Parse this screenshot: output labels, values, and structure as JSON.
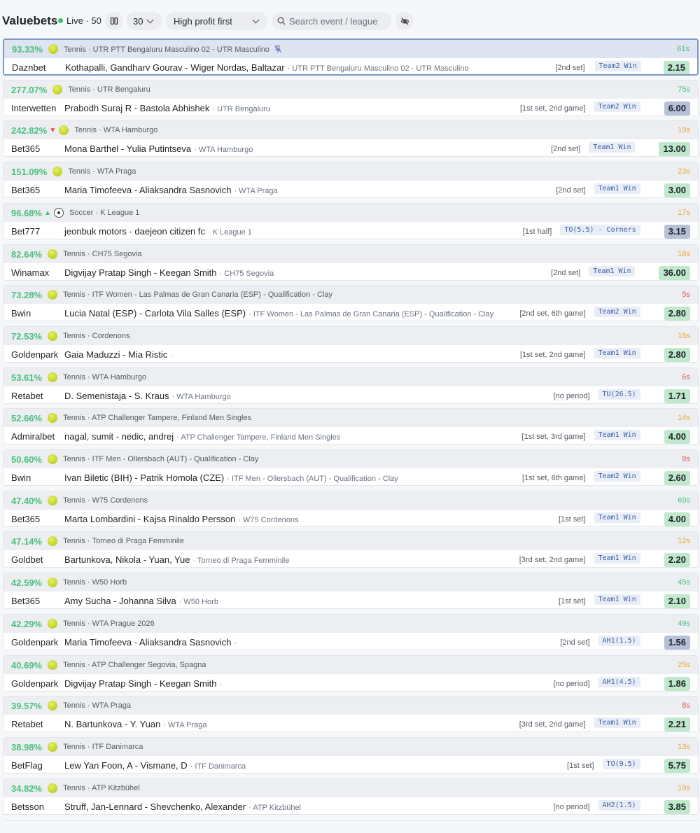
{
  "app": {
    "title": "Valuebets",
    "live_label": "Live · 50",
    "count_select": "30",
    "sort_select": "High profit first",
    "search_placeholder": "Search event / league",
    "colors": {
      "profit": "#4cc080",
      "live_dot": "#3fbf6f",
      "odds_green": "#bfe8cc",
      "odds_blue": "#b6c1d9",
      "market_text": "#3f5fa3"
    }
  },
  "bets": [
    {
      "profit": "93.33%",
      "trend": "",
      "sport": "tennis-ball-icon",
      "league_line": "Tennis · UTR PTT Bengaluru Masculino 02 - UTR Masculino",
      "pinned": true,
      "age": "61s",
      "age_color": "green",
      "bookie": "Daznbet",
      "event": "Kothapalli, Gandharv Gourav - Wiger Nordas, Baltazar",
      "event_league": "· UTR PTT Bengaluru Masculino 02 - UTR Masculino",
      "period": "[2nd set]",
      "market": "Team2 Win",
      "odds": "2.15",
      "odds_color": "green",
      "selected": true
    },
    {
      "profit": "277.07%",
      "trend": "",
      "sport": "tennis-ball-icon",
      "league_line": "Tennis · UTR Bengaluru",
      "pinned": false,
      "age": "75s",
      "age_color": "green",
      "bookie": "Interwetten",
      "event": "Prabodh Suraj R - Bastola Abhishek",
      "event_league": "· UTR Bengaluru",
      "period": "[1st set, 2nd game]",
      "market": "Team2 Win",
      "odds": "6.00",
      "odds_color": "blue",
      "selected": false
    },
    {
      "profit": "242.82%",
      "trend": "down",
      "sport": "tennis-ball-icon",
      "league_line": "Tennis · WTA Hamburgo",
      "pinned": false,
      "age": "19s",
      "age_color": "orange",
      "bookie": "Bet365",
      "event": "Mona Barthel - Yulia Putintseva",
      "event_league": "· WTA Hamburgo",
      "period": "[2nd set]",
      "market": "Team1 Win",
      "odds": "13.00",
      "odds_color": "green",
      "selected": false
    },
    {
      "profit": "151.09%",
      "trend": "",
      "sport": "tennis-ball-icon",
      "league_line": "Tennis · WTA Praga",
      "pinned": false,
      "age": "23s",
      "age_color": "orange",
      "bookie": "Bet365",
      "event": "Maria Timofeeva - Aliaksandra Sasnovich",
      "event_league": "· WTA Praga",
      "period": "[2nd set]",
      "market": "Team1 Win",
      "odds": "3.00",
      "odds_color": "green",
      "selected": false
    },
    {
      "profit": "96.68%",
      "trend": "up",
      "sport": "soccer-ball-icon",
      "league_line": "Soccer · K League 1",
      "pinned": false,
      "age": "17s",
      "age_color": "orange",
      "bookie": "Bet777",
      "event": "jeonbuk motors - daejeon citizen fc",
      "event_league": "· K League 1",
      "period": "[1st half]",
      "market": "TO(5.5) - Corners",
      "odds": "3.15",
      "odds_color": "blue",
      "selected": false
    },
    {
      "profit": "82.64%",
      "trend": "",
      "sport": "tennis-ball-icon",
      "league_line": "Tennis · CH75 Segovia",
      "pinned": false,
      "age": "18s",
      "age_color": "orange",
      "bookie": "Winamax",
      "event": "Digvijay Pratap Singh - Keegan Smith",
      "event_league": "· CH75 Segovia",
      "period": "[2nd set]",
      "market": "Team1 Win",
      "odds": "36.00",
      "odds_color": "green",
      "selected": false
    },
    {
      "profit": "73.28%",
      "trend": "",
      "sport": "tennis-ball-icon",
      "league_line": "Tennis · ITF Women - Las Palmas de Gran Canaria (ESP) - Qualification - Clay",
      "pinned": false,
      "age": "5s",
      "age_color": "red",
      "bookie": "Bwin",
      "event": "Lucia Natal (ESP) - Carlota Vila Salles (ESP)",
      "event_league": "· ITF Women - Las Palmas de Gran Canaria (ESP) - Qualification - Clay",
      "period": "[2nd set, 6th game]",
      "market": "Team2 Win",
      "odds": "2.80",
      "odds_color": "green",
      "selected": false
    },
    {
      "profit": "72.53%",
      "trend": "",
      "sport": "tennis-ball-icon",
      "league_line": "Tennis · Cordenons",
      "pinned": false,
      "age": "16s",
      "age_color": "orange",
      "bookie": "Goldenpark",
      "event": "Gaia Maduzzi - Mia Ristic",
      "event_league": "·",
      "period": "[1st set, 2nd game]",
      "market": "Team1 Win",
      "odds": "2.80",
      "odds_color": "green",
      "selected": false
    },
    {
      "profit": "53.61%",
      "trend": "",
      "sport": "tennis-ball-icon",
      "league_line": "Tennis · WTA Hamburgo",
      "pinned": false,
      "age": "6s",
      "age_color": "red",
      "bookie": "Retabet",
      "event": "D. Semenistaja - S. Kraus",
      "event_league": "· WTA Hamburgo",
      "period": "[no period]",
      "market": "TU(26.5)",
      "odds": "1.71",
      "odds_color": "green",
      "selected": false
    },
    {
      "profit": "52.66%",
      "trend": "",
      "sport": "tennis-ball-icon",
      "league_line": "Tennis · ATP Challenger Tampere, Finland Men Singles",
      "pinned": false,
      "age": "14s",
      "age_color": "orange",
      "bookie": "Admiralbet",
      "event": "nagal, sumit - nedic, andrej",
      "event_league": "· ATP Challenger Tampere, Finland Men Singles",
      "period": "[1st set, 3rd game]",
      "market": "Team1 Win",
      "odds": "4.00",
      "odds_color": "green",
      "selected": false
    },
    {
      "profit": "50.60%",
      "trend": "",
      "sport": "tennis-ball-icon",
      "league_line": "Tennis · ITF Men - Ollersbach (AUT) - Qualification - Clay",
      "pinned": false,
      "age": "8s",
      "age_color": "red",
      "bookie": "Bwin",
      "event": "Ivan Biletic (BIH) - Patrik Homola (CZE)",
      "event_league": "· ITF Men - Ollersbach (AUT) - Qualification - Clay",
      "period": "[1st set, 6th game]",
      "market": "Team2 Win",
      "odds": "2.60",
      "odds_color": "green",
      "selected": false
    },
    {
      "profit": "47.40%",
      "trend": "",
      "sport": "tennis-ball-icon",
      "league_line": "Tennis · W75 Cordenons",
      "pinned": false,
      "age": "69s",
      "age_color": "green",
      "bookie": "Bet365",
      "event": "Marta Lombardini - Kajsa Rinaldo Persson",
      "event_league": "· W75 Cordenons",
      "period": "[1st set]",
      "market": "Team1 Win",
      "odds": "4.00",
      "odds_color": "green",
      "selected": false
    },
    {
      "profit": "47.14%",
      "trend": "",
      "sport": "tennis-ball-icon",
      "league_line": "Tennis · Torneo di Praga Femminile",
      "pinned": false,
      "age": "12s",
      "age_color": "orange",
      "bookie": "Goldbet",
      "event": "Bartunkova, Nikola - Yuan, Yue",
      "event_league": "· Torneo di Praga Femminile",
      "period": "[3rd set, 2nd game]",
      "market": "Team1 Win",
      "odds": "2.20",
      "odds_color": "green",
      "selected": false
    },
    {
      "profit": "42.59%",
      "trend": "",
      "sport": "tennis-ball-icon",
      "league_line": "Tennis · W50 Horb",
      "pinned": false,
      "age": "45s",
      "age_color": "green",
      "bookie": "Bet365",
      "event": "Amy Sucha - Johanna Silva",
      "event_league": "· W50 Horb",
      "period": "[1st set]",
      "market": "Team1 Win",
      "odds": "2.10",
      "odds_color": "green",
      "selected": false
    },
    {
      "profit": "42.29%",
      "trend": "",
      "sport": "tennis-ball-icon",
      "league_line": "Tennis · WTA Prague 2026",
      "pinned": false,
      "age": "49s",
      "age_color": "green",
      "bookie": "Goldenpark",
      "event": "Maria Timofeeva - Aliaksandra Sasnovich",
      "event_league": "·",
      "period": "[2nd set]",
      "market": "AH1(1.5)",
      "odds": "1.56",
      "odds_color": "blue",
      "selected": false
    },
    {
      "profit": "40.69%",
      "trend": "",
      "sport": "tennis-ball-icon",
      "league_line": "Tennis · ATP Challenger Segovia, Spagna",
      "pinned": false,
      "age": "25s",
      "age_color": "orange",
      "bookie": "Goldenpark",
      "event": "Digvijay Pratap Singh - Keegan Smith",
      "event_league": "·",
      "period": "[no period]",
      "market": "AH1(4.5)",
      "odds": "1.86",
      "odds_color": "green",
      "selected": false
    },
    {
      "profit": "39.57%",
      "trend": "",
      "sport": "tennis-ball-icon",
      "league_line": "Tennis · WTA Praga",
      "pinned": false,
      "age": "8s",
      "age_color": "red",
      "bookie": "Retabet",
      "event": "N. Bartunkova - Y. Yuan",
      "event_league": "· WTA Praga",
      "period": "[3rd set, 2nd game]",
      "market": "Team1 Win",
      "odds": "2.21",
      "odds_color": "green",
      "selected": false
    },
    {
      "profit": "38.98%",
      "trend": "",
      "sport": "tennis-ball-icon",
      "league_line": "Tennis · ITF Danimarca",
      "pinned": false,
      "age": "13s",
      "age_color": "orange",
      "bookie": "BetFlag",
      "event": "Lew Yan Foon, A - Vismane, D",
      "event_league": "· ITF Danimarca",
      "period": "[1st set]",
      "market": "TO(9.5)",
      "odds": "5.75",
      "odds_color": "green",
      "selected": false
    },
    {
      "profit": "34.82%",
      "trend": "",
      "sport": "tennis-ball-icon",
      "league_line": "Tennis · ATP Kitzbühel",
      "pinned": false,
      "age": "19s",
      "age_color": "orange",
      "bookie": "Betsson",
      "event": "Struff, Jan-Lennard - Shevchenko, Alexander",
      "event_league": "· ATP Kitzbühel",
      "period": "[no period]",
      "market": "AH2(1.5)",
      "odds": "3.85",
      "odds_color": "green",
      "selected": false
    }
  ]
}
